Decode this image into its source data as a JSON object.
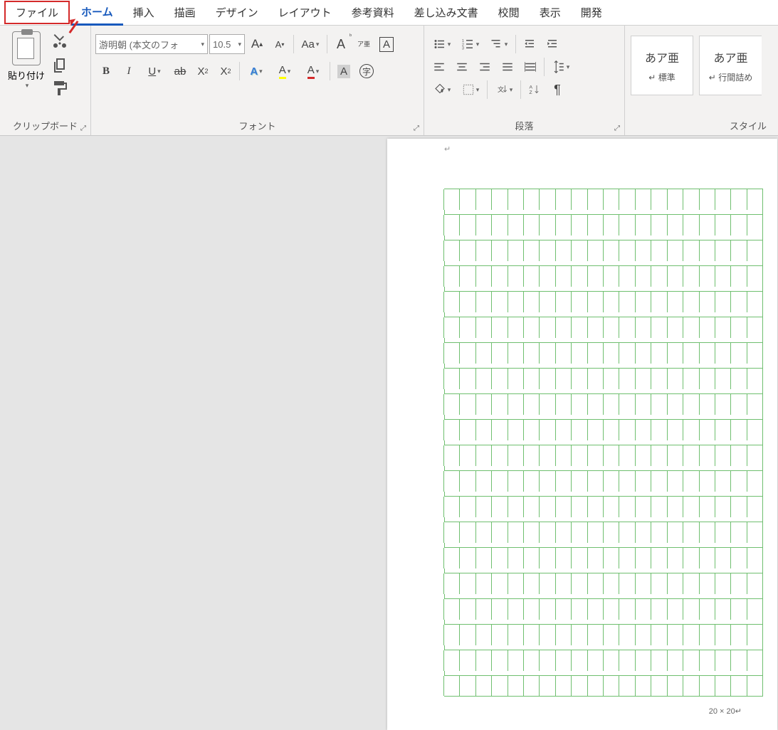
{
  "tabs": {
    "file": "ファイル",
    "home": "ホーム",
    "insert": "挿入",
    "draw": "描画",
    "design": "デザイン",
    "layout": "レイアウト",
    "references": "参考資料",
    "mailings": "差し込み文書",
    "review": "校閲",
    "view": "表示",
    "developer": "開発"
  },
  "clipboard": {
    "paste": "貼り付け",
    "group_label": "クリップボード"
  },
  "font": {
    "name": "游明朝 (本文のフォ",
    "size": "10.5",
    "group_label": "フォント",
    "change_case": "Aa",
    "ruby": "ア亜",
    "bold": "B",
    "italic": "I",
    "underline": "U",
    "strike": "ab",
    "subscript": "X₂",
    "superscript": "X²",
    "text_effects": "A",
    "highlight": "A",
    "font_color": "A",
    "char_shading": "A",
    "enclose": "字"
  },
  "paragraph": {
    "group_label": "段落"
  },
  "styles": {
    "group_label": "スタイル",
    "sample": "あア亜",
    "normal": "標準",
    "no_spacing": "行間詰め"
  },
  "page": {
    "footer": "20 × 20",
    "grid_rows": 20,
    "grid_cols": 20
  },
  "colors": {
    "highlight_yellow": "#ffff00",
    "font_red": "#d42a2a",
    "text_effects_blue": "#3a7bd5"
  }
}
